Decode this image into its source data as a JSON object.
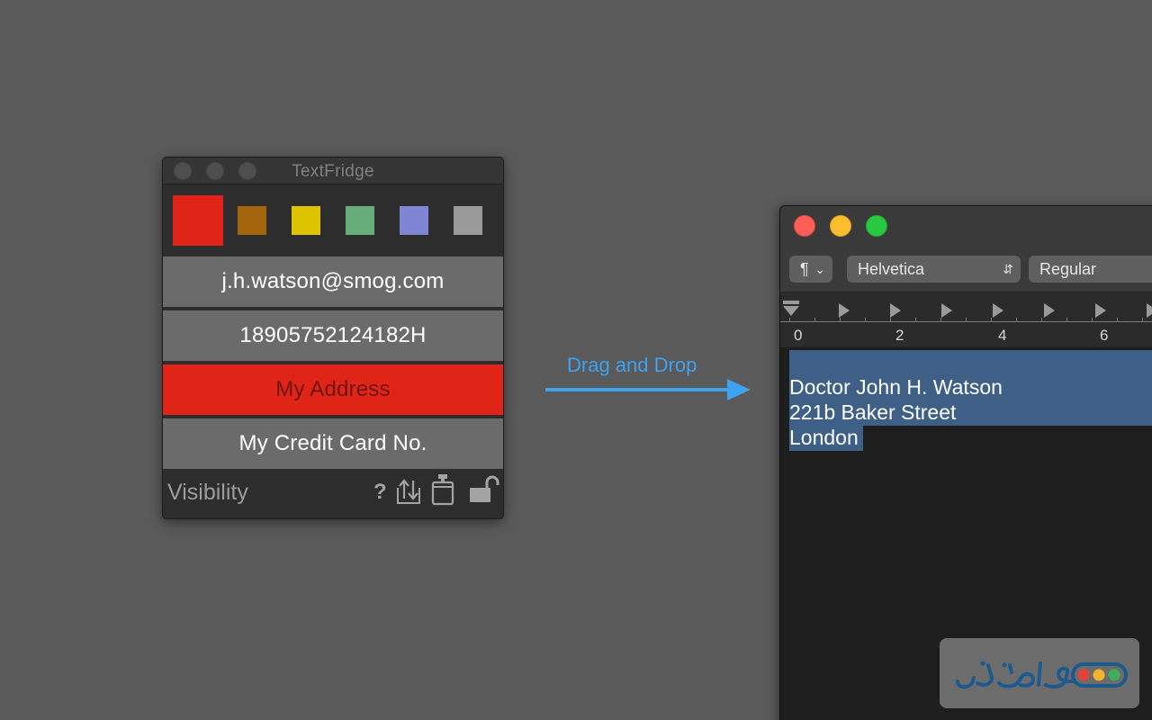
{
  "textfridge": {
    "title": "TextFridge",
    "swatch_colors": [
      "#e02418",
      "#a5650c",
      "#dcc400",
      "#66ad7c",
      "#7f85d3",
      "#9a9a9a"
    ],
    "items": [
      {
        "label": "j.h.watson@smog.com"
      },
      {
        "label": "18905752124182H"
      },
      {
        "label": "My Address"
      },
      {
        "label": "My Credit Card No."
      }
    ],
    "footer": {
      "visibility_label": "Visibility",
      "help_label": "?"
    },
    "icons": [
      "help-icon",
      "import-export-icon",
      "clipboard-icon",
      "unlock-icon"
    ]
  },
  "drag_hint": {
    "label": "Drag and Drop",
    "color": "#3da2f0"
  },
  "textedit": {
    "paragraph_label": "¶",
    "font_family": "Helvetica",
    "font_style": "Regular",
    "ruler_numbers": [
      "0",
      "2",
      "4",
      "6"
    ],
    "document_lines": [
      "Doctor John H. Watson",
      "221b Baker Street",
      "London"
    ],
    "selection_color": "#3e5f86"
  },
  "watermark": {
    "brand_colors": [
      "#e0433a",
      "#f0b52a",
      "#3fae5a"
    ]
  }
}
